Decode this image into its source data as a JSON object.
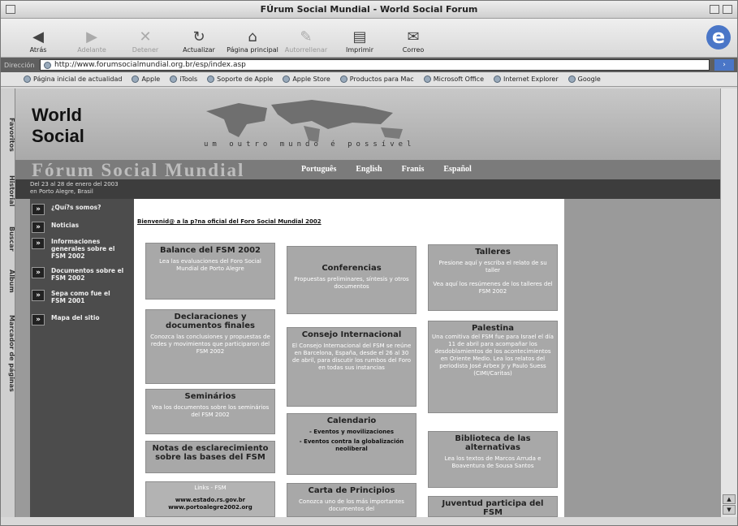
{
  "window": {
    "title": "FÚrum Social Mundial - World Social Forum"
  },
  "toolbar": {
    "back": "Atrás",
    "forward": "Adelante",
    "stop": "Detener",
    "refresh": "Actualizar",
    "home": "Página principal",
    "autofill": "Autorrellenar",
    "print": "Imprimir",
    "mail": "Correo"
  },
  "address": {
    "label": "Dirección",
    "url": "http://www.forumsocialmundial.org.br/esp/index.asp"
  },
  "favorites": [
    "Página inicial de actualidad",
    "Apple",
    "iTools",
    "Soporte de Apple",
    "Apple Store",
    "Productos para Mac",
    "Microsoft Office",
    "Internet Explorer",
    "Google"
  ],
  "sidetabs": [
    "Favoritos",
    "Historial",
    "Buscar",
    "Álbum",
    "Marcador de páginas"
  ],
  "banner": {
    "line1": "World",
    "line2": "Social",
    "tagline": "um outro mundo é possível",
    "fsm": "Fórum Social Mundial",
    "langs": [
      "Português",
      "English",
      "Franis",
      "Español"
    ],
    "date1": "Del 23 al 28 de enero del 2003",
    "date2": "en Porto Alegre, Brasil"
  },
  "nav": [
    "¿Quí?s somos?",
    "Noticias",
    "Informaciones generales sobre el FSM 2002",
    "Documentos sobre el FSM 2002",
    "Sepa como fue el FSM 2001",
    "Mapa del sitio"
  ],
  "main": {
    "welcome": "Bienvenid@ a la p?na oficial del Foro Social Mundial 2002",
    "col1": [
      {
        "title": "Balance del FSM 2002",
        "text": "Lea las evaluaciones del Foro Social Mundial de Porto Alegre"
      },
      {
        "title": "Declaraciones y documentos finales",
        "text": "Conozca las conclusiones y propuestas de redes y movimientos que participaron del FSM 2002"
      },
      {
        "title": "Seminários",
        "text": "Vea los documentos sobre los seminários del FSM 2002"
      },
      {
        "title": "Notas de esclarecimiento sobre las bases del FSM",
        "text": ""
      },
      {
        "title": "Links - FSM",
        "text": "www.estado.rs.gov.br www.portoalegre2002.org"
      }
    ],
    "col2": [
      {
        "title": "Conferencias",
        "text": "Propuestas preliminares, síntesis y otros documentos"
      },
      {
        "title": "Consejo Internacional",
        "text": "El Consejo Internacional del FSM se reúne en Barcelona, España, desde el 26 al 30 de abril, para discutir los rumbos del Foro en todas sus instancias"
      },
      {
        "title": "Calendario",
        "link1": "- Eventos y movilizaciones",
        "link2": "- Eventos contra la globalización neoliberal"
      },
      {
        "title": "Carta de Principios",
        "text": "Conozca uno de los más importantes documentos del"
      }
    ],
    "col3": [
      {
        "title": "Talleres",
        "text1": "Presione aquí y escriba el relato de su taller",
        "text2": "Vea aquí los resúmenes de los talleres del FSM 2002"
      },
      {
        "title": "Palestina",
        "text": "Una comitiva del FSM fue para Israel el día 11 de abril para acompañar los desdoblamientos de los acontecimientos en Oriente Medio. Lea los relatos del periodista José Arbex Jr y Paulo Suess (CIMI/Caritas)"
      },
      {
        "title": "Biblioteca de las alternativas",
        "text": "Lea los textos de Marcos Arruda e Boaventura de Sousa Santos"
      },
      {
        "title": "Juventud participa del FSM",
        "text": ""
      }
    ]
  }
}
